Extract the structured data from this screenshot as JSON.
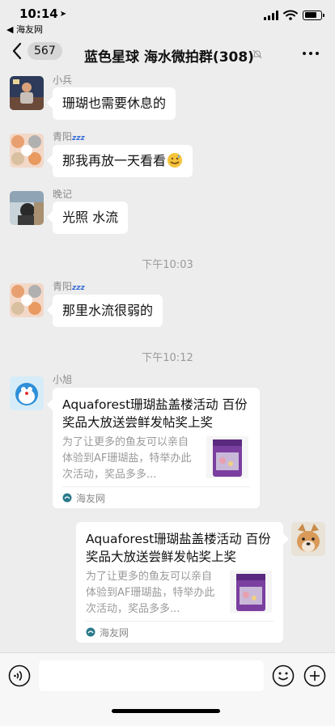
{
  "status_bar": {
    "time": "10:14",
    "back_app": "◀ 海友网",
    "battery_level": 0.8
  },
  "nav": {
    "unread_count": "567",
    "title": "蓝色星球 海水微拍群(308)"
  },
  "messages": [
    {
      "sender": "小兵",
      "text": "珊瑚也需要休息的"
    },
    {
      "sender": "青阳",
      "text": "那我再放一天看看"
    },
    {
      "sender": "晚记",
      "text": "光照 水流"
    },
    {
      "sender": "青阳",
      "text": "那里水流很弱的"
    }
  ],
  "timestamps": [
    "下午10:03",
    "下午10:12"
  ],
  "cards": [
    {
      "sender": "小旭",
      "title": "Aquaforest珊瑚盐盖楼活动 百份奖品大放送尝鲜发帖奖上奖",
      "desc": "为了让更多的鱼友可以亲自体验到AF珊瑚盐，特举办此次活动，奖品多多...",
      "source": "海友网"
    },
    {
      "title": "Aquaforest珊瑚盐盖楼活动 百份奖品大放送尝鲜发帖奖上奖",
      "desc": "为了让更多的鱼友可以亲自体验到AF珊瑚盐，特举办此次活动，奖品多多...",
      "source": "海友网"
    }
  ],
  "qingyang_badge": "zzz",
  "input": {
    "placeholder": ""
  },
  "colors": {
    "background": "#ededed",
    "bubble": "#ffffff",
    "meta_text": "#9a9a9a",
    "accent": "#3b6fd8"
  }
}
